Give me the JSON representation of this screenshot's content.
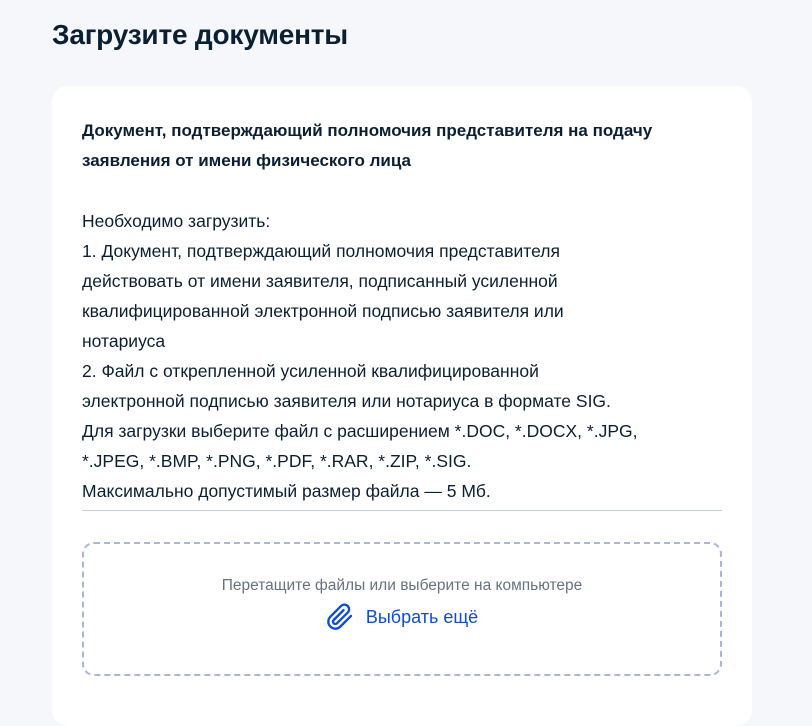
{
  "page": {
    "title": "Загрузите документы"
  },
  "document": {
    "title": "Документ, подтверждающий полномочия представителя на подачу заявления от имени физического лица",
    "description_lines": [
      "Необходимо загрузить:",
      "1. Документ, подтверждающий полномочия представителя",
      "действовать от имени заявителя, подписанный усиленной",
      "квалифицированной электронной подписью заявителя или",
      "нотариуса",
      "2. Файл с открепленной усиленной квалифицированной",
      "электронной подписью заявителя или нотариуса в формате SIG.",
      "Для загрузки выберите файл с расширением *.DOC, *.DOCX, *.JPG,",
      "*.JPEG, *.BMP, *.PNG, *.PDF, *.RAR, *.ZIP, *.SIG.",
      "Максимально допустимый размер файла — 5 Мб."
    ]
  },
  "dropzone": {
    "hint": "Перетащите файлы или выберите на компьютере",
    "choose_label": "Выбрать ещё",
    "icon": "paperclip-icon"
  },
  "colors": {
    "link": "#0d4cd3",
    "dropzone_border": "#a8b5d6",
    "page_background": "#f5f7fb",
    "text": "#0b1f33",
    "hint": "#66727f"
  }
}
